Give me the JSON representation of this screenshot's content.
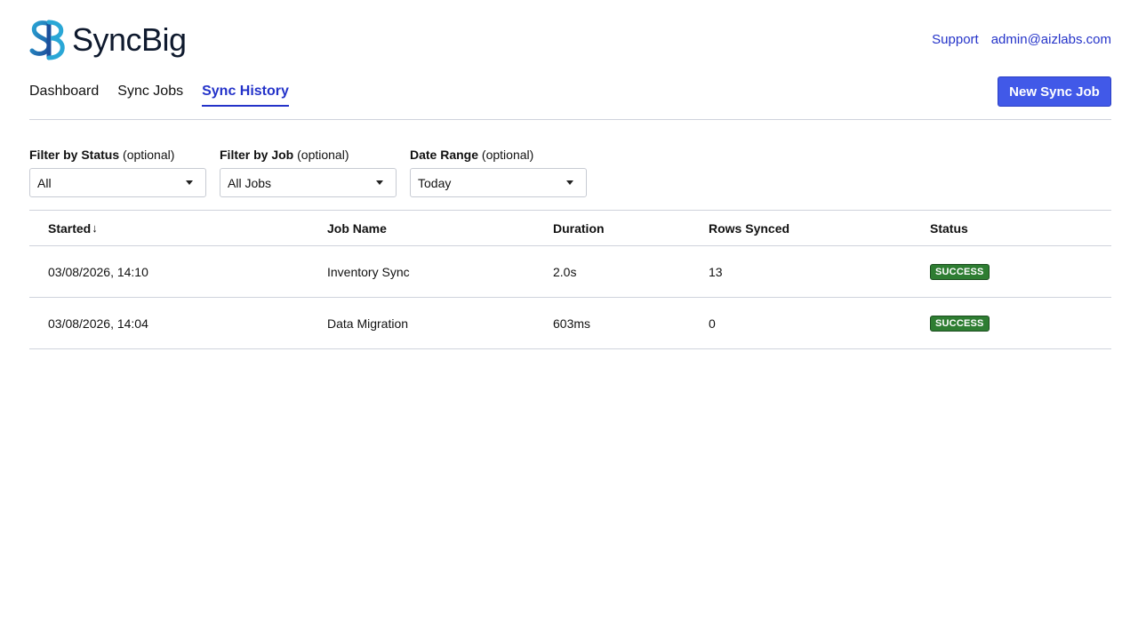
{
  "app": {
    "name": "SyncBig",
    "brand_color": "#2433c9"
  },
  "top_links": {
    "support": "Support",
    "user_email": "admin@aizlabs.com"
  },
  "nav": {
    "tabs": [
      {
        "label": "Dashboard",
        "active": false
      },
      {
        "label": "Sync Jobs",
        "active": false
      },
      {
        "label": "Sync History",
        "active": true
      }
    ],
    "new_job_label": "New Sync Job"
  },
  "filters": {
    "status": {
      "label": "Filter by Status",
      "hint": "(optional)",
      "value": "All"
    },
    "job": {
      "label": "Filter by Job",
      "hint": "(optional)",
      "value": "All Jobs"
    },
    "date": {
      "label": "Date Range",
      "hint": "(optional)",
      "value": "Today"
    }
  },
  "table": {
    "headers": [
      "Started",
      "Job Name",
      "Duration",
      "Rows Synced",
      "Status"
    ],
    "sort_icon": "arrow-down-icon",
    "rows": [
      {
        "started": "03/08/2026, 14:10",
        "job": "Inventory Sync",
        "duration": "2.0s",
        "rows": "13",
        "status": "SUCCESS"
      },
      {
        "started": "03/08/2026, 14:04",
        "job": "Data Migration",
        "duration": "603ms",
        "rows": "0",
        "status": "SUCCESS"
      }
    ],
    "status_color": "#2e7d32"
  }
}
